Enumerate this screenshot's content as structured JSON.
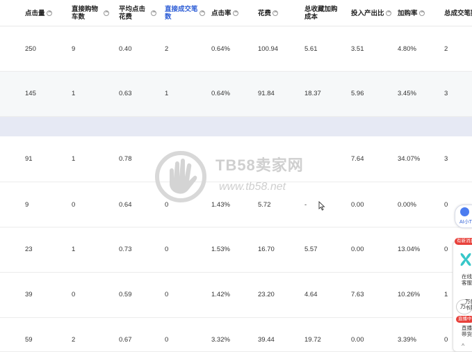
{
  "columns": [
    {
      "label": "点击量",
      "active": false
    },
    {
      "label": "直接购物车数",
      "active": false
    },
    {
      "label": "平均点击花费",
      "active": false
    },
    {
      "label": "直接成交笔数",
      "active": true
    },
    {
      "label": "点击率",
      "active": false
    },
    {
      "label": "花费",
      "active": false
    },
    {
      "label": "总收藏加购成本",
      "active": false
    },
    {
      "label": "投入产出比",
      "active": false
    },
    {
      "label": "加购率",
      "active": false
    },
    {
      "label": "总成交笔数",
      "active": false
    }
  ],
  "rows": [
    [
      "250",
      "9",
      "0.40",
      "2",
      "0.64%",
      "100.94",
      "5.61",
      "3.51",
      "4.80%",
      "2"
    ],
    [
      "145",
      "1",
      "0.63",
      "1",
      "0.64%",
      "91.84",
      "18.37",
      "5.96",
      "3.45%",
      "3"
    ],
    [
      "91",
      "1",
      "0.78",
      "",
      "",
      "",
      "",
      "7.64",
      "34.07%",
      "3"
    ],
    [
      "9",
      "0",
      "0.64",
      "0",
      "1.43%",
      "5.72",
      "-",
      "0.00",
      "0.00%",
      "0"
    ],
    [
      "23",
      "1",
      "0.73",
      "0",
      "1.53%",
      "16.70",
      "5.57",
      "0.00",
      "13.04%",
      "0"
    ],
    [
      "39",
      "0",
      "0.59",
      "0",
      "1.42%",
      "23.20",
      "4.64",
      "7.63",
      "10.26%",
      "1"
    ],
    [
      "59",
      "2",
      "0.67",
      "0",
      "3.32%",
      "39.44",
      "19.72",
      "0.00",
      "3.39%",
      "0"
    ]
  ],
  "watermark": {
    "title": "TB58卖家网",
    "url": "www.tb58.net"
  },
  "float_bar": {
    "ai_label": "AI小T",
    "badge_new": "有新消息",
    "online_service": [
      "在线",
      "客服"
    ],
    "wan_icon": "万",
    "wan_label": [
      "万象",
      "书院"
    ],
    "badge_live": "直播中",
    "live_label": [
      "直播",
      "带货"
    ]
  },
  "colors": {
    "accent": "#2f5fd6",
    "band": "#e6e9f4",
    "alt_row": "#f6f8f9",
    "badge": "#e8413b"
  }
}
